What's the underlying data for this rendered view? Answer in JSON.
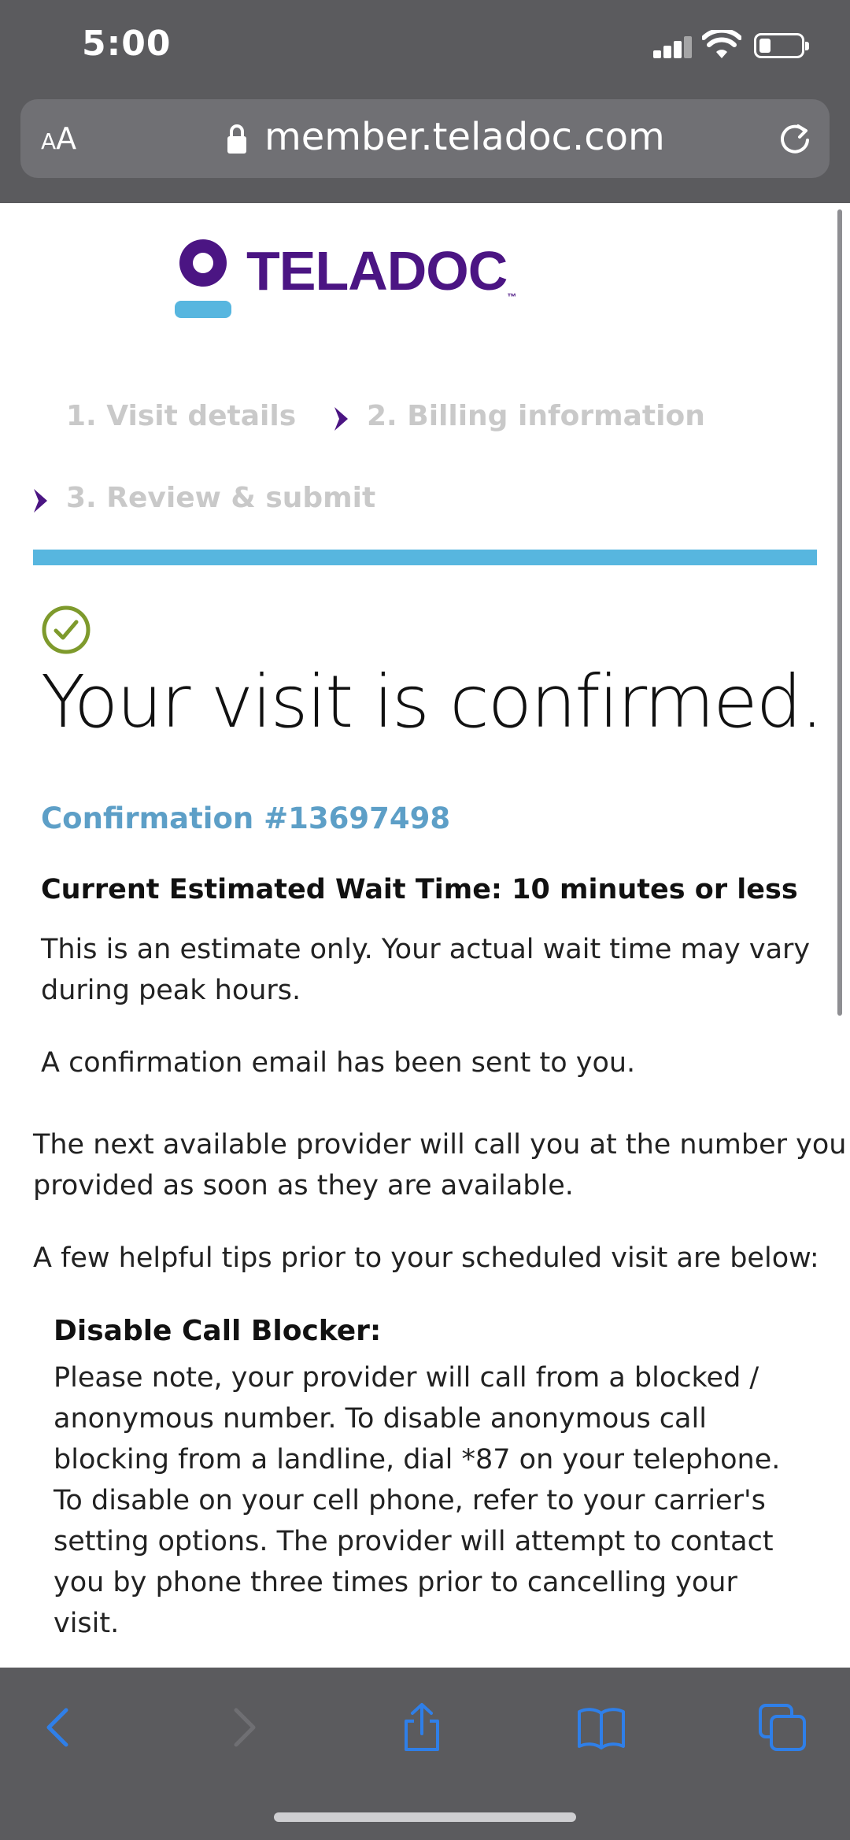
{
  "status_bar": {
    "time": "5:00"
  },
  "browser": {
    "text_size_label_small": "A",
    "text_size_label_large": "A",
    "url": "member.teladoc.com"
  },
  "logo": {
    "text": "TELADOC",
    "tm": "™"
  },
  "steps": [
    {
      "label": "1. Visit details"
    },
    {
      "label": "2. Billing information"
    },
    {
      "label": "3. Review & submit"
    }
  ],
  "confirmation": {
    "headline": "Your visit is confirmed.",
    "number": "Confirmation #13697498",
    "wait_time": "Current Estimated Wait Time: 10 minutes or less",
    "estimate_note_line1": "This is an estimate only. Your actual wait time may vary",
    "estimate_note_line2": "during peak hours.",
    "email_note": "A confirmation email has been sent to you.",
    "provider_call_line1": "The next available provider will call you at the number you",
    "provider_call_line2": "provided as soon as they are available.",
    "tips_intro": "A few helpful tips prior to your scheduled visit are below:"
  },
  "tip": {
    "title": "Disable Call Blocker:",
    "lines": [
      "Please note, your provider will call from a blocked /",
      "anonymous number. To disable anonymous call",
      "blocking from a landline, dial *87 on your telephone.",
      "To disable on your cell phone, refer to your carrier's",
      "setting options. The provider will attempt to contact",
      "you by phone three times prior to cancelling your",
      "visit."
    ]
  },
  "colors": {
    "brand_purple": "#4b1583",
    "brand_blue": "#57b6df",
    "confirm_blue": "#5d9fc7",
    "check_green": "#7e9a2c",
    "ios_blue": "#2f7fe8"
  },
  "icons": [
    "lock-icon",
    "reload-icon",
    "chevron-right-icon",
    "check-circle-icon",
    "back-icon",
    "forward-icon",
    "share-icon",
    "bookmarks-icon",
    "tabs-icon"
  ]
}
